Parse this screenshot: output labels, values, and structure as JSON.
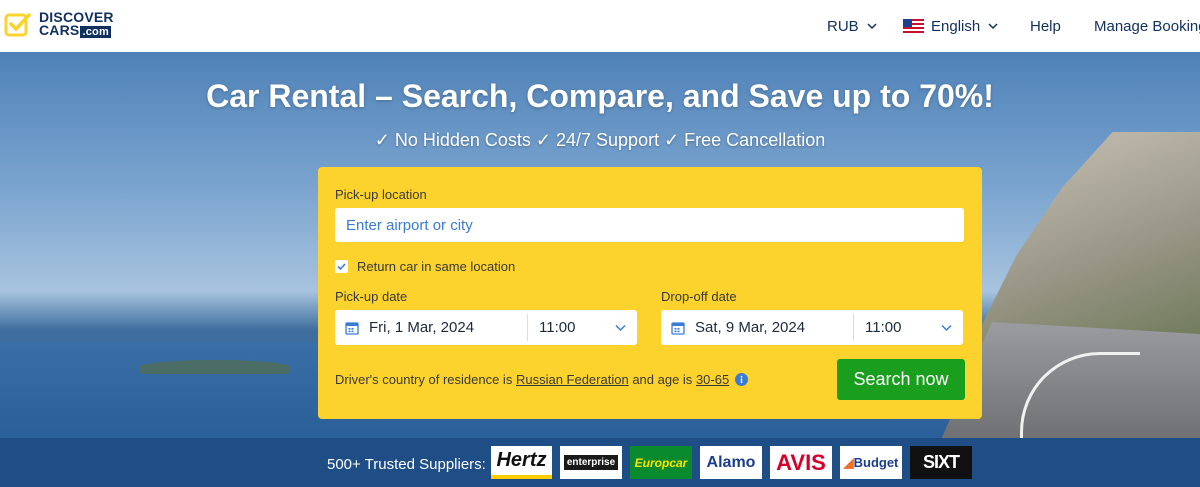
{
  "brand": {
    "name_line1": "DISCOVER",
    "name_line2": "CARS",
    "name_suffix": ".com",
    "primary_color": "#10305e",
    "logo_accent_color": "#fcd22c"
  },
  "nav": {
    "currency": "RUB",
    "language": "English",
    "language_flag_icon": "us-flag-icon",
    "help": "Help",
    "manage_booking": "Manage Booking"
  },
  "hero": {
    "title": "Car Rental – Search, Compare, and Save up to 70%!",
    "subtitle": "✓ No Hidden Costs ✓ 24/7 Support ✓ Free Cancellation"
  },
  "search": {
    "box_color": "#fcd22c",
    "pickup_location_label": "Pick-up location",
    "pickup_location_placeholder": "Enter airport or city",
    "return_same_location_label": "Return car in same location",
    "return_same_location_checked": true,
    "pickup_date_label": "Pick-up date",
    "pickup_date": "Fri, 1 Mar, 2024",
    "pickup_time": "11:00",
    "dropoff_date_label": "Drop-off date",
    "dropoff_date": "Sat, 9 Mar, 2024",
    "dropoff_time": "11:00",
    "residence_prefix": "Driver's country of residence is",
    "residence_country": "Russian Federation",
    "age_prefix": "and age is",
    "age_range": "30-65",
    "search_button": "Search now",
    "search_button_color": "#1a9e1e"
  },
  "suppliers": {
    "label": "500+ Trusted Suppliers:",
    "logos": [
      "Hertz",
      "enterprise",
      "Europcar",
      "Alamo",
      "AVIS",
      "Budget",
      "SIXT"
    ]
  }
}
